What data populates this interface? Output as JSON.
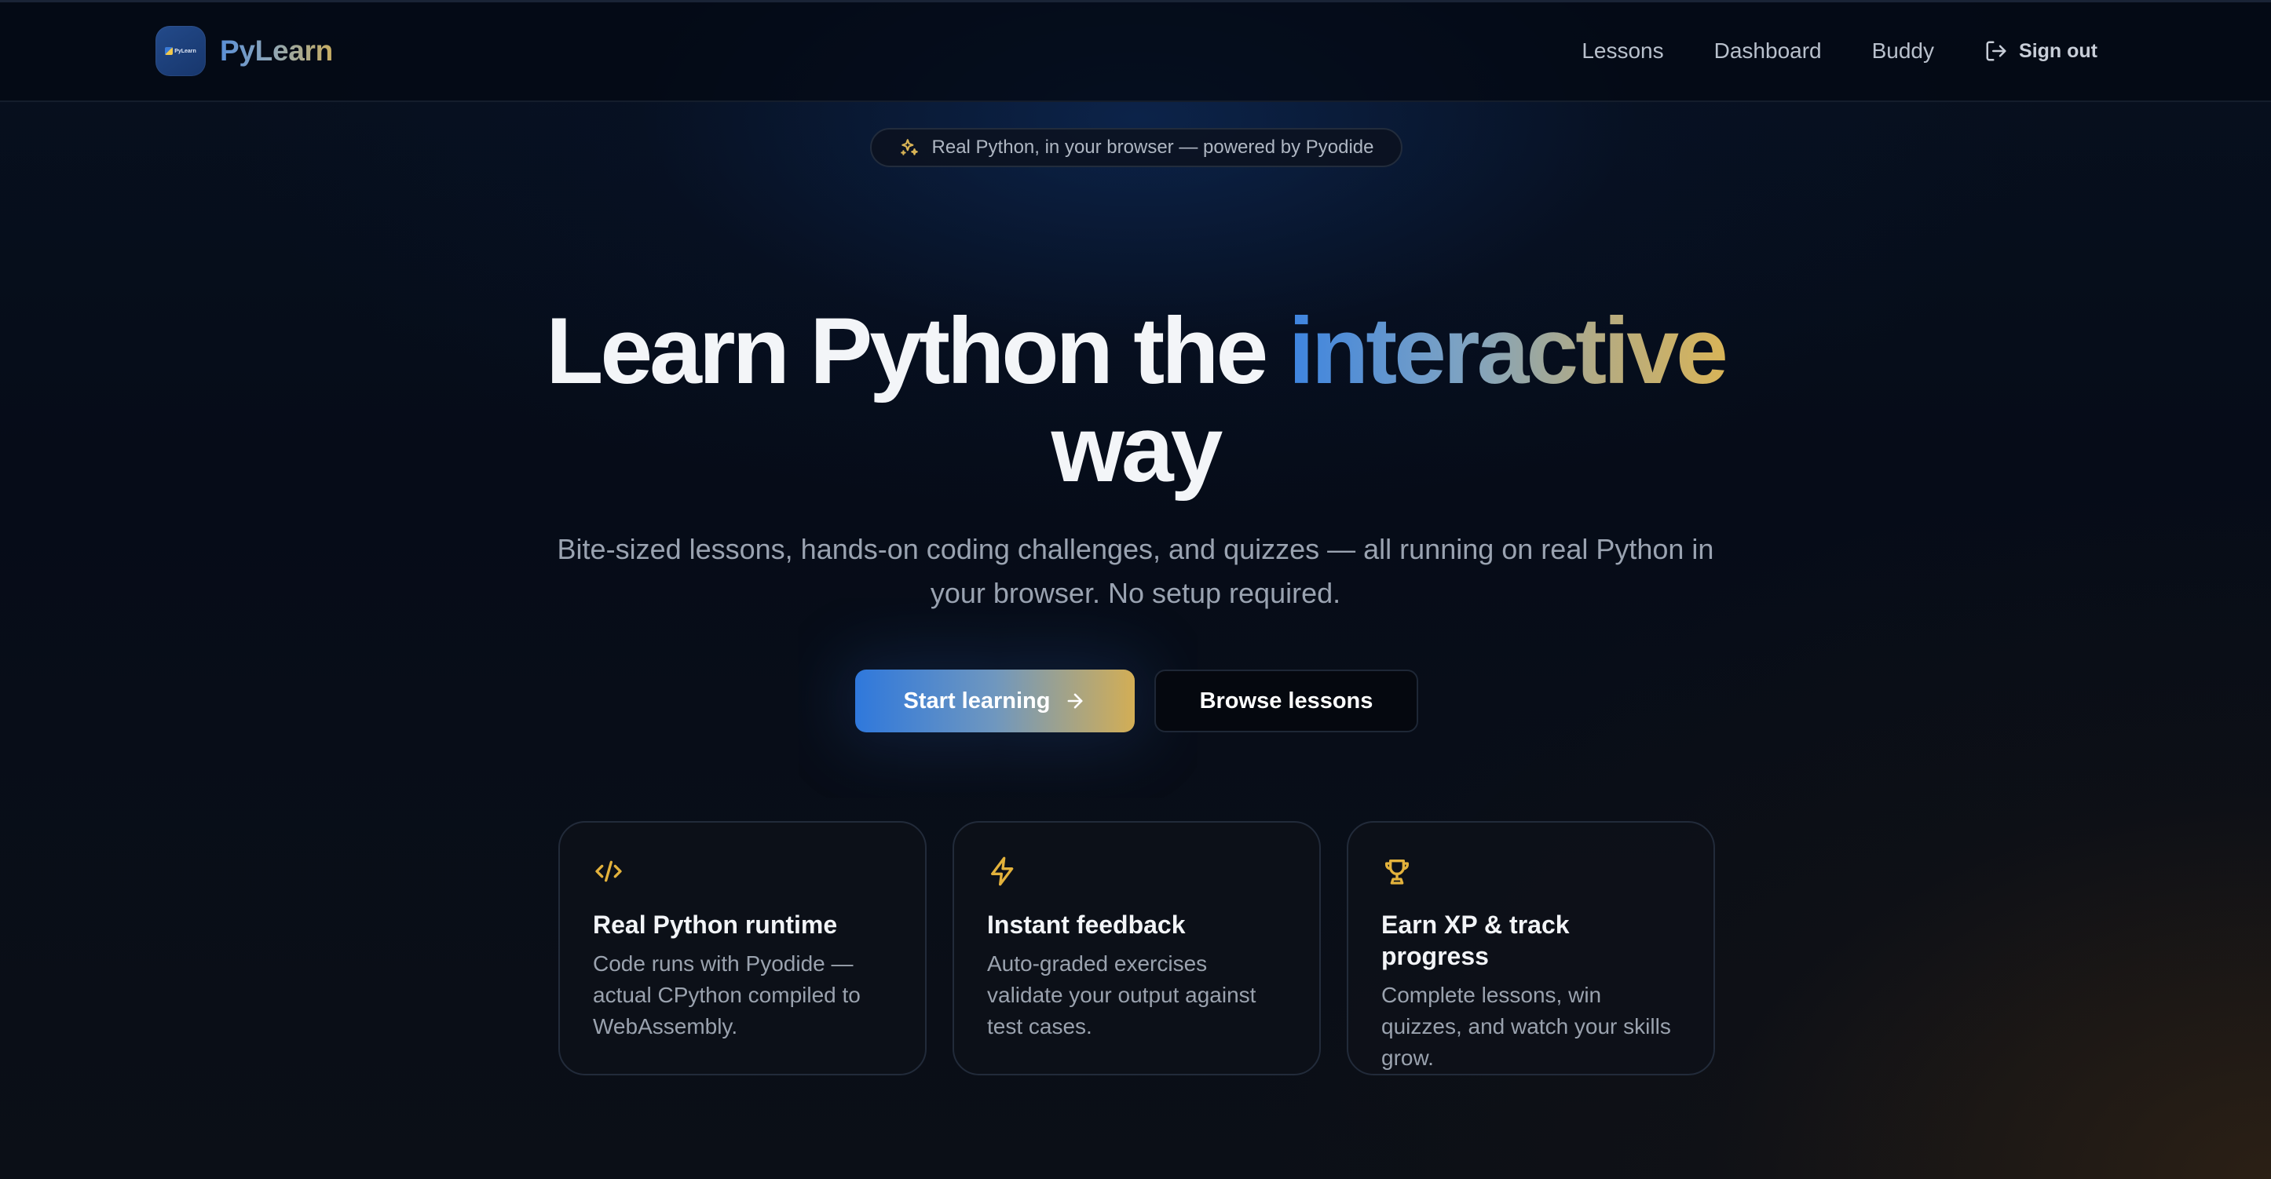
{
  "brand": {
    "name": "PyLearn",
    "logo_text": "PyLearn"
  },
  "nav": {
    "items": [
      {
        "label": "Lessons"
      },
      {
        "label": "Dashboard"
      },
      {
        "label": "Buddy"
      }
    ],
    "sign_out_label": "Sign out"
  },
  "hero": {
    "badge_text": "Real Python, in your browser — powered by Pyodide",
    "headline_plain": "Learn Python the ",
    "headline_accent": "interactive",
    "headline_end": "way",
    "subtitle": "Bite-sized lessons, hands-on coding challenges, and quizzes — all running on real Python in your browser. No setup required.",
    "primary_cta": "Start learning",
    "secondary_cta": "Browse lessons"
  },
  "features": [
    {
      "icon": "code-icon",
      "title": "Real Python runtime",
      "description": "Code runs with Pyodide — actual CPython compiled to WebAssembly."
    },
    {
      "icon": "lightning-icon",
      "title": "Instant feedback",
      "description": "Auto-graded exercises validate your output against test cases."
    },
    {
      "icon": "trophy-icon",
      "title": "Earn XP & track progress",
      "description": "Complete lessons, win quizzes, and watch your skills grow."
    }
  ],
  "colors": {
    "accent_blue": "#2f78dc",
    "accent_gold": "#d8b458",
    "background": "#07101f"
  }
}
